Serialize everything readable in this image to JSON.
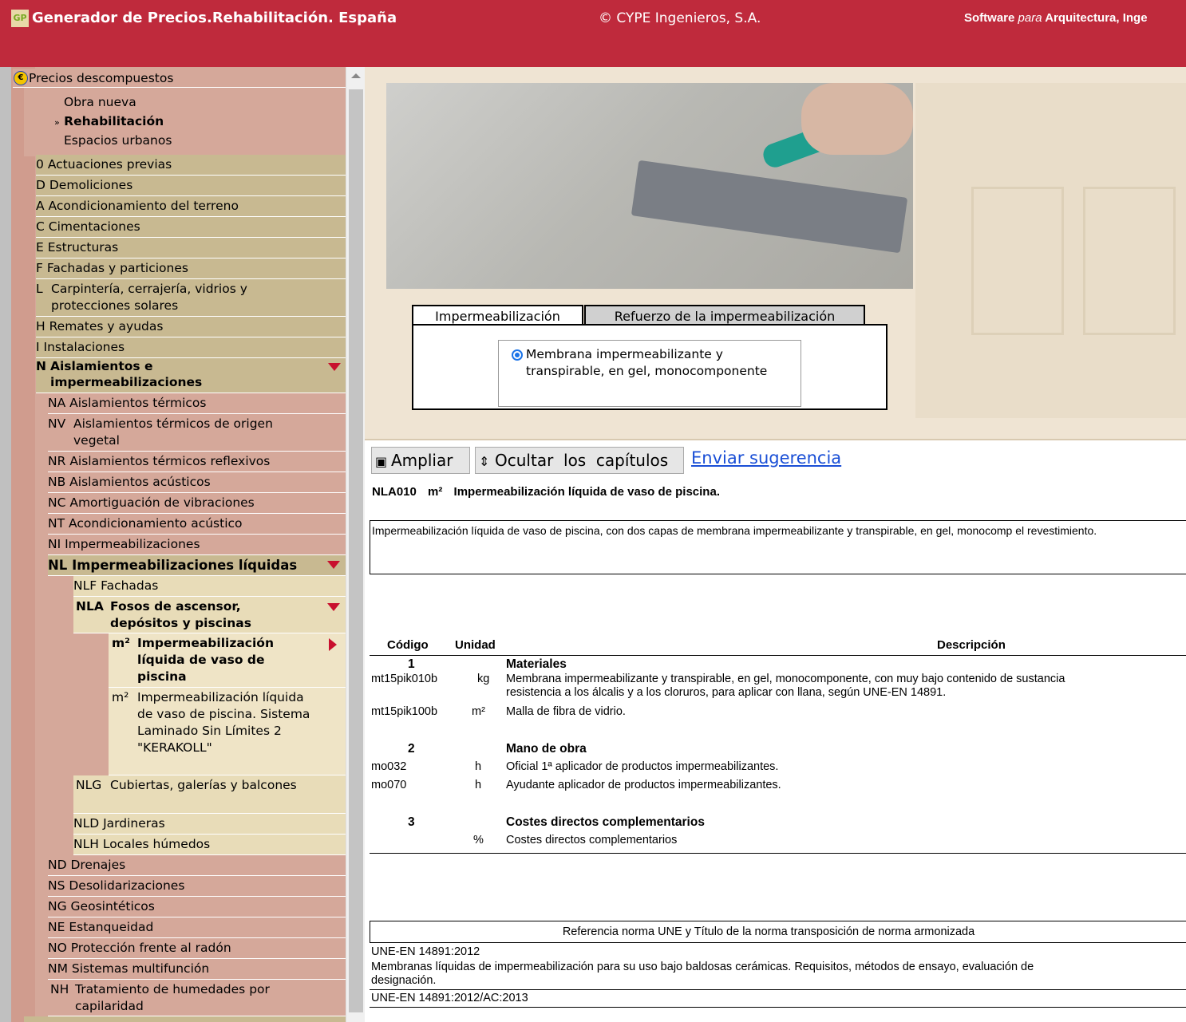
{
  "header": {
    "logo_icon": "cype-logo-icon",
    "title": "Generador de Precios.Rehabilitación. España",
    "copyright": "© CYPE Ingenieros, S.A.",
    "software_prefix": "Software",
    "software_italic": "para",
    "software_suffix": "Arquitectura, Inge"
  },
  "sidebar": {
    "root_label": "Precios descompuestos",
    "root_icon": "euro-icon",
    "sub_items": [
      "Obra nueva",
      "Rehabilitación",
      "Espacios urbanos"
    ],
    "selected_sub_prefix": "»",
    "chapters": [
      {
        "code": "0",
        "label": "Actuaciones previas"
      },
      {
        "code": "D",
        "label": "Demoliciones"
      },
      {
        "code": "A",
        "label": "Acondicionamiento del terreno"
      },
      {
        "code": "C",
        "label": "Cimentaciones"
      },
      {
        "code": "E",
        "label": "Estructuras"
      },
      {
        "code": "F",
        "label": "Fachadas y particiones"
      },
      {
        "code": "L",
        "label": "Carpintería, cerrajería, vidrios y protecciones solares"
      },
      {
        "code": "H",
        "label": "Remates y ayudas"
      },
      {
        "code": "I",
        "label": "Instalaciones"
      },
      {
        "code": "N",
        "label": "Aislamientos e impermeabilizaciones"
      }
    ],
    "n_children": [
      {
        "code": "NA",
        "label": "Aislamientos térmicos"
      },
      {
        "code": "NV",
        "label": "Aislamientos térmicos de origen vegetal"
      },
      {
        "code": "NR",
        "label": "Aislamientos térmicos reflexivos"
      },
      {
        "code": "NB",
        "label": "Aislamientos acústicos"
      },
      {
        "code": "NC",
        "label": "Amortiguación de vibraciones"
      },
      {
        "code": "NT",
        "label": "Acondicionamiento acústico"
      },
      {
        "code": "NI",
        "label": "Impermeabilizaciones"
      },
      {
        "code": "NL",
        "label": "Impermeabilizaciones líquidas"
      }
    ],
    "nl_children": [
      {
        "code": "NLF",
        "label": "Fachadas"
      },
      {
        "code": "NLA",
        "label": "Fosos de ascensor, depósitos y piscinas"
      }
    ],
    "nla_children": [
      {
        "unit": "m²",
        "label": "Impermeabilización líquida de vaso de piscina"
      },
      {
        "unit": "m²",
        "label": "Impermeabilización líquida de vaso de piscina. Sistema Laminado Sin Límites 2 \"KERAKOLL\""
      }
    ],
    "nl_rest": [
      {
        "code": "NLG",
        "label": "Cubiertas, galerías y balcones"
      },
      {
        "code": "NLD",
        "label": "Jardineras"
      },
      {
        "code": "NLH",
        "label": "Locales húmedos"
      }
    ],
    "n_rest": [
      {
        "code": "ND",
        "label": "Drenajes"
      },
      {
        "code": "NS",
        "label": "Desolidarizaciones"
      },
      {
        "code": "NG",
        "label": "Geosintéticos"
      },
      {
        "code": "NE",
        "label": "Estanqueidad"
      },
      {
        "code": "NO",
        "label": "Protección frente al radón"
      },
      {
        "code": "NM",
        "label": "Sistemas multifunción"
      },
      {
        "code": "NH",
        "label": "Tratamiento de humedades por capilaridad"
      }
    ]
  },
  "tabs": {
    "active": "Impermeabilización",
    "inactive": "Refuerzo de la impermeabilización",
    "option_label": "Membrana impermeabilizante y transpirable, en gel, monocomponente"
  },
  "toolbar": {
    "ampliar": "Ampliar",
    "ampliar_icon": "zoom-page-icon",
    "ocultar": "Ocultar  los  capítulos",
    "ocultar_icon": "hide-chapters-icon",
    "sugerencia": "Enviar sugerencia"
  },
  "item": {
    "code": "NLA010",
    "unit": "m²",
    "title": "Impermeabilización líquida de vaso de piscina."
  },
  "description": "Impermeabilización líquida de vaso de piscina, con dos capas de membrana impermeabilizante y transpirable, en gel, monocomp el revestimiento.",
  "decomposition": {
    "headers": {
      "code": "Código",
      "unit": "Unidad",
      "desc": "Descripción"
    },
    "groups": [
      {
        "num": "1",
        "title": "Materiales",
        "rows": [
          {
            "code": "mt15pik010b",
            "unit": "kg",
            "desc": "Membrana impermeabilizante y transpirable, en gel, monocomponente, con muy bajo contenido de sustancia",
            "desc2": "resistencia a los álcalis y a los cloruros, para aplicar con llana, según UNE-EN 14891."
          },
          {
            "code": "mt15pik100b",
            "unit": "m²",
            "desc": "Malla de fibra de vidrio."
          }
        ]
      },
      {
        "num": "2",
        "title": "Mano de obra",
        "rows": [
          {
            "code": "mo032",
            "unit": "h",
            "desc": "Oficial 1ª aplicador de productos impermeabilizantes."
          },
          {
            "code": "mo070",
            "unit": "h",
            "desc": "Ayudante aplicador de productos impermeabilizantes."
          }
        ]
      },
      {
        "num": "3",
        "title": "Costes directos complementarios",
        "rows": [
          {
            "code": "",
            "unit": "%",
            "desc": "Costes directos complementarios"
          }
        ]
      }
    ]
  },
  "norms": {
    "header": "Referencia norma UNE y Título de la norma transposición de norma armonizada",
    "ref1": "UNE-EN 14891:2012",
    "title1": "Membranas líquidas de impermeabilización para su uso bajo baldosas cerámicas. Requisitos, métodos de ensayo, evaluación de",
    "title1b": "designación.",
    "ref2": "UNE-EN 14891:2012/AC:2013"
  }
}
